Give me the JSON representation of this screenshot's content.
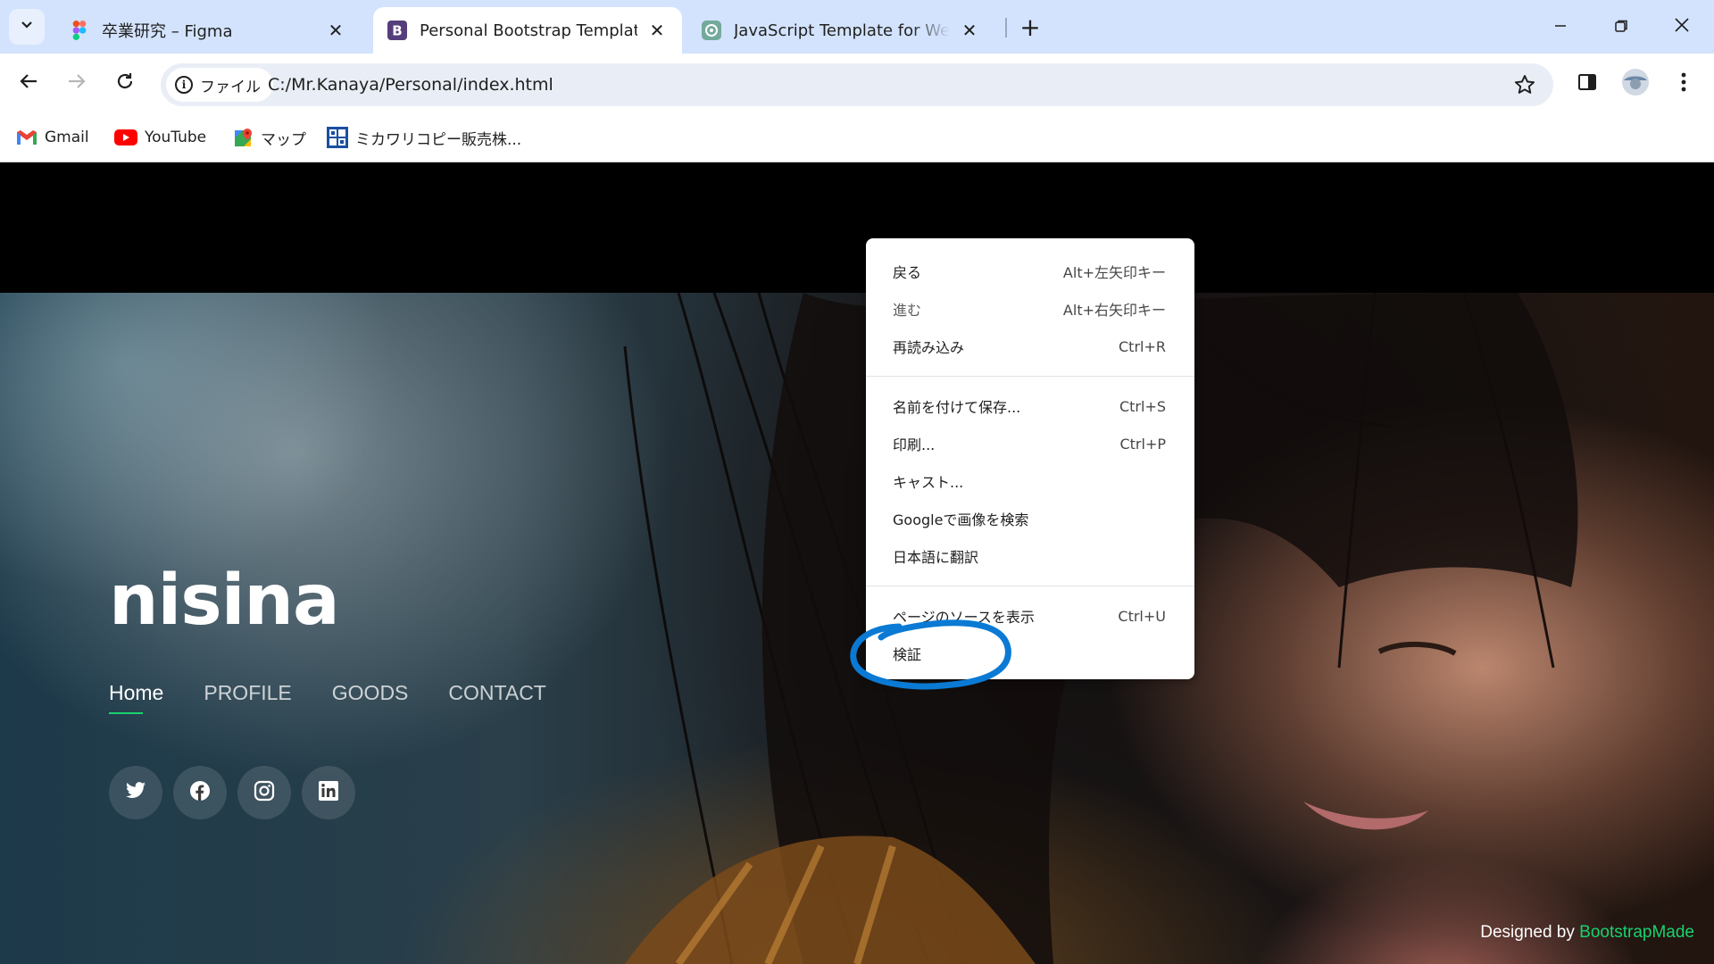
{
  "browser": {
    "tabs": [
      {
        "title": "卒業研究 – Figma",
        "icon": "figma-icon",
        "active": false
      },
      {
        "title": "Personal Bootstrap Template",
        "icon": "bootstrap-icon",
        "active": true
      },
      {
        "title": "JavaScript Template for Websit",
        "icon": "chatgpt-icon",
        "active": false
      }
    ],
    "omnibox": {
      "chip_label": "ファイル",
      "url": "C:/Mr.Kanaya/Personal/index.html"
    },
    "bookmarks": [
      {
        "label": "Gmail",
        "icon": "gmail-icon"
      },
      {
        "label": "YouTube",
        "icon": "youtube-icon"
      },
      {
        "label": "マップ",
        "icon": "maps-icon"
      },
      {
        "label": "ミカワリコピー販売株...",
        "icon": "mikawa-icon"
      }
    ]
  },
  "site": {
    "brand": "nisina",
    "nav": [
      {
        "label": "Home",
        "active": true
      },
      {
        "label": "PROFILE",
        "active": false
      },
      {
        "label": "GOODS",
        "active": false
      },
      {
        "label": "CONTACT",
        "active": false
      }
    ],
    "socials": [
      "twitter-icon",
      "facebook-icon",
      "instagram-icon",
      "linkedin-icon"
    ],
    "credits_prefix": "Designed by ",
    "credits_link": "BootstrapMade"
  },
  "context_menu": {
    "groups": [
      [
        {
          "label": "戻る",
          "shortcut": "Alt+左矢印キー"
        },
        {
          "label": "進む",
          "shortcut": "Alt+右矢印キー",
          "disabled": true
        },
        {
          "label": "再読み込み",
          "shortcut": "Ctrl+R"
        }
      ],
      [
        {
          "label": "名前を付けて保存...",
          "shortcut": "Ctrl+S"
        },
        {
          "label": "印刷...",
          "shortcut": "Ctrl+P"
        },
        {
          "label": "キャスト...",
          "shortcut": ""
        },
        {
          "label": "Googleで画像を検索",
          "shortcut": ""
        },
        {
          "label": "日本語に翻訳",
          "shortcut": ""
        }
      ],
      [
        {
          "label": "ページのソースを表示",
          "shortcut": "Ctrl+U"
        },
        {
          "label": "検証",
          "shortcut": ""
        }
      ]
    ]
  },
  "colors": {
    "tabstrip": "#d3e3fd",
    "accent_green": "#18d26e",
    "annotation_blue": "#0a7ad4"
  }
}
